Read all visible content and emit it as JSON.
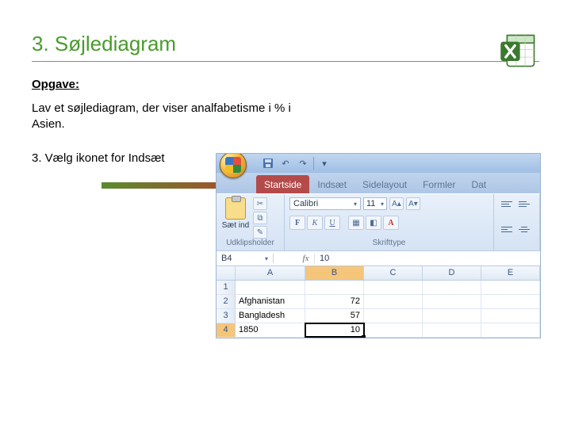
{
  "title": "3. Søjlediagram",
  "opgave_label": "Opgave:",
  "description": "Lav et søjlediagram, der viser analfabetisme i % i Asien.",
  "step": "3. Vælg ikonet for Indsæt",
  "excel": {
    "qat": {
      "save_tip": "Gem",
      "undo_tip": "Fortryd",
      "redo_tip": "Gentag"
    },
    "tabs": [
      "Startside",
      "Indsæt",
      "Sidelayout",
      "Formler",
      "Dat"
    ],
    "highlight_tab_index": 0,
    "ribbon": {
      "clipboard": {
        "paste": "Sæt ind",
        "label": "Udklipsholder"
      },
      "font": {
        "name": "Calibri",
        "size": "11",
        "bold": "F",
        "italic": "K",
        "underline": "U",
        "label": "Skrifttype"
      },
      "align": {
        "label": ""
      }
    },
    "namebox": "B4",
    "fx_value": "10",
    "columns": [
      "A",
      "B",
      "C",
      "D",
      "E"
    ],
    "rows": [
      {
        "n": "1",
        "A": "",
        "B": ""
      },
      {
        "n": "2",
        "A": "Afghanistan",
        "B": "72"
      },
      {
        "n": "3",
        "A": "Bangladesh",
        "B": "57"
      },
      {
        "n": "4",
        "A": "1850",
        "B": "10",
        "selected": true
      }
    ]
  }
}
